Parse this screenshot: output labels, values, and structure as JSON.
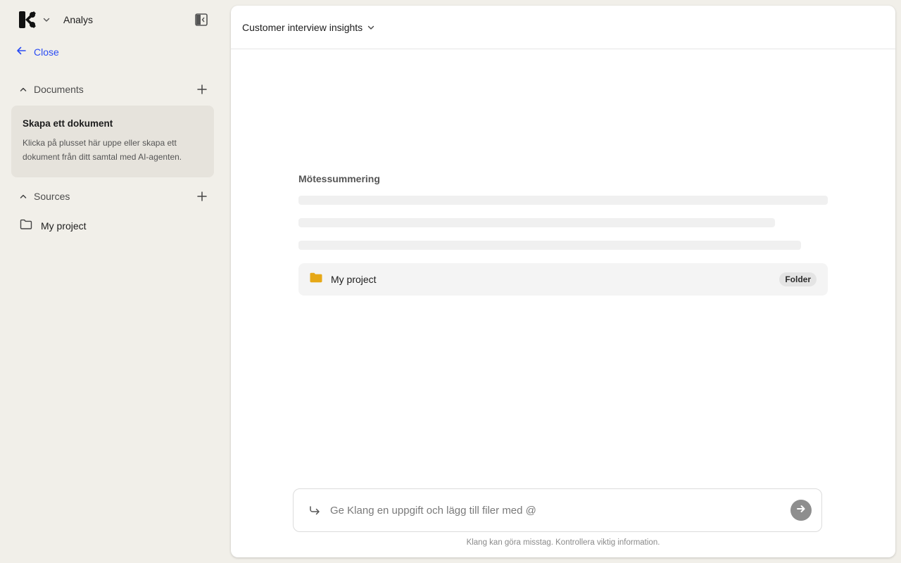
{
  "sidebar": {
    "workspace_name": "Analys",
    "close_label": "Close",
    "documents": {
      "title": "Documents",
      "empty_title": "Skapa ett dokument",
      "empty_body": "Klicka på plusset här uppe eller skapa ett dokument från ditt samtal med AI-agenten."
    },
    "sources": {
      "title": "Sources",
      "items": [
        {
          "label": "My project",
          "icon": "folder-outline-icon"
        }
      ]
    }
  },
  "main": {
    "document_title": "Customer interview insights",
    "section_heading": "Mötessummering",
    "skeleton_lines": [
      1.0,
      0.9,
      0.95
    ],
    "folder_card": {
      "name": "My project",
      "badge": "Folder"
    },
    "composer": {
      "placeholder": "Ge Klang en uppgift och lägg till filer med @"
    },
    "disclaimer": "Klang kan göra misstag. Kontrollera viktig information."
  },
  "colors": {
    "sidebar_bg": "#f1efe9",
    "link_accent": "#2a4cf4",
    "folder_yellow": "#e6a817",
    "send_button": "#8e8e8e"
  }
}
